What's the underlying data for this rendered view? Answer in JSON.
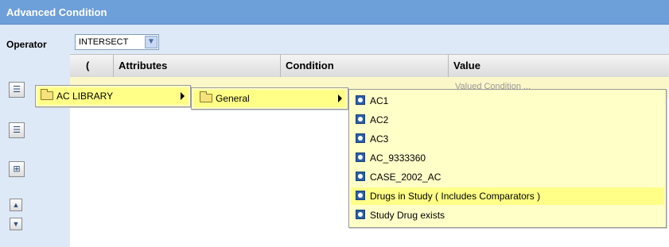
{
  "panel": {
    "title": "Advanced Condition"
  },
  "operator": {
    "label": "Operator",
    "value": "INTERSECT"
  },
  "grid": {
    "columns": [
      "(",
      "Attributes",
      "Condition",
      "Value"
    ],
    "value_hint": "Valued Condition ..."
  },
  "menus": {
    "level1": {
      "label": "AC LIBRARY"
    },
    "level2": {
      "label": "General"
    },
    "level3": {
      "items": [
        "AC1",
        "AC2",
        "AC3",
        "AC_9333360",
        "CASE_2002_AC",
        "Drugs in Study ( Includes Comparators )",
        "Study Drug exists"
      ],
      "highlighted_index": 5
    }
  },
  "icons": {
    "operator_dropdown": "chevron-down-icon",
    "side_buttons": [
      "add-condition-icon",
      "add-row-icon",
      "group-icon",
      "move-up-icon",
      "move-down-icon"
    ],
    "menu_folder": "folder-icon",
    "menu_item": "condition-icon"
  },
  "colors": {
    "title_bar": "#6d9fd8",
    "panel_bg": "#dde9f7",
    "menu_bg": "#ffffc8",
    "menu_highlight": "#ffff88"
  }
}
